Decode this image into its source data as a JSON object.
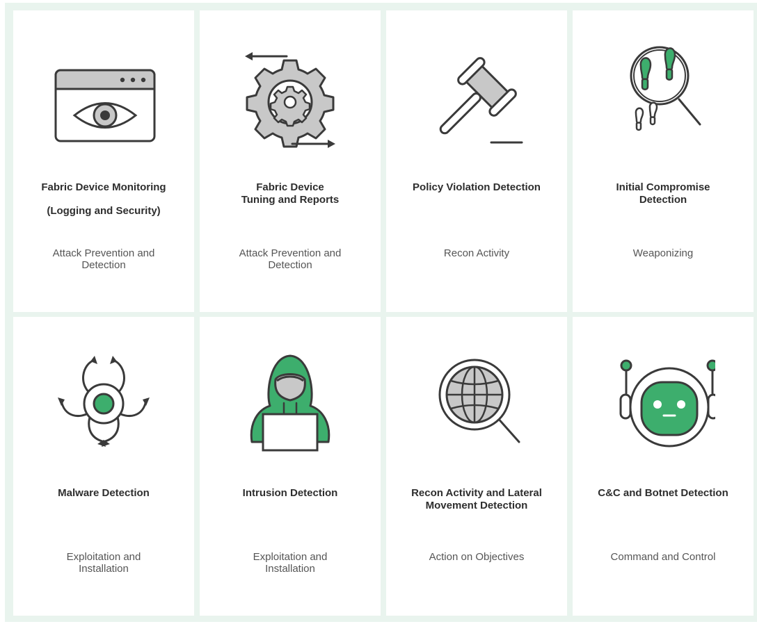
{
  "cards": [
    {
      "title_lines": [
        "Fabric Device Monitoring",
        "(Logging and Security)"
      ],
      "subtitle_lines": [
        "Attack Prevention and",
        "Detection"
      ],
      "icon": "browser-eye-icon"
    },
    {
      "title_lines": [
        "Fabric Device",
        "Tuning and Reports"
      ],
      "subtitle_lines": [
        "Attack Prevention and",
        "Detection"
      ],
      "icon": "gear-arrows-icon"
    },
    {
      "title_lines": [
        "Policy Violation Detection"
      ],
      "subtitle_lines": [
        "Recon Activity"
      ],
      "icon": "gavel-icon"
    },
    {
      "title_lines": [
        "Initial Compromise",
        "Detection"
      ],
      "subtitle_lines": [
        "Weaponizing"
      ],
      "icon": "footprints-magnifier-icon"
    },
    {
      "title_lines": [
        "Malware Detection"
      ],
      "subtitle_lines": [
        "Exploitation and",
        "Installation"
      ],
      "icon": "biohazard-icon"
    },
    {
      "title_lines": [
        "Intrusion Detection"
      ],
      "subtitle_lines": [
        "Exploitation and",
        "Installation"
      ],
      "icon": "hooded-hacker-icon"
    },
    {
      "title_lines": [
        "Recon Activity and Lateral",
        "Movement Detection"
      ],
      "subtitle_lines": [
        "Action on Objectives"
      ],
      "icon": "globe-magnifier-icon"
    },
    {
      "title_lines": [
        "C&C and Botnet Detection"
      ],
      "subtitle_lines": [
        "Command and Control"
      ],
      "icon": "robot-head-icon"
    }
  ],
  "colors": {
    "accent_green": "#3dae6d",
    "stroke_dark": "#3a3a3a",
    "fill_gray": "#c8c8c8",
    "background_tint": "#e9f4ee"
  }
}
